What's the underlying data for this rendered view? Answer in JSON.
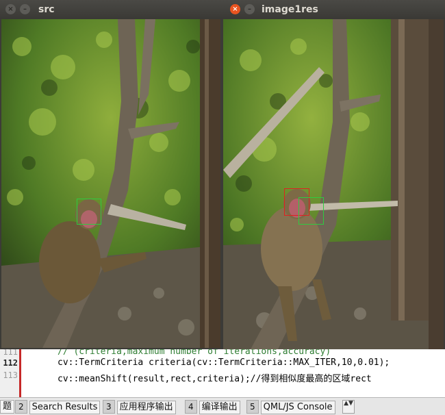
{
  "editor": {
    "lines": [
      {
        "num": "",
        "code": "// (criteria,maximum number of iterations,accuracy)",
        "type": "comment"
      },
      {
        "num": "112",
        "code": "cv::TermCriteria criteria(cv::TermCriteria::MAX_ITER,10,0.01);",
        "type": "code"
      },
      {
        "num": "113",
        "code": "cv::meanShift(result,rect,criteria);//得到相似度最高的区域rect",
        "type": "code"
      }
    ],
    "first_line_num": "111"
  },
  "panel": {
    "partial_label": "题",
    "tabs": [
      {
        "num": "2",
        "label": "Search Results"
      },
      {
        "num": "3",
        "label": "应用程序输出"
      },
      {
        "num": "4",
        "label": "编译输出"
      },
      {
        "num": "5",
        "label": "QML/JS Console"
      }
    ],
    "arrows": "▲▼"
  },
  "windows": {
    "src": {
      "title": "src",
      "close": "×",
      "min": "–",
      "box_color": "#2ecc40"
    },
    "res": {
      "title": "image1res",
      "close": "×",
      "min": "–",
      "box_color": "#e02020",
      "box2_color": "#2ecc40"
    }
  }
}
